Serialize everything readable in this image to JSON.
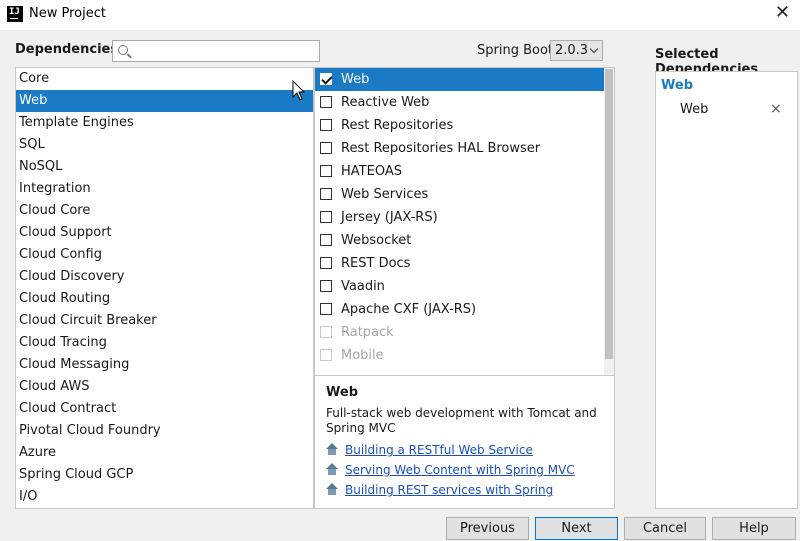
{
  "window": {
    "app_icon_text": "IJ",
    "title": "New Project",
    "close_glyph": "✕"
  },
  "header": {
    "dependencies_label": "Dependencies",
    "search_value": "",
    "spring_boot_label": "Spring Boot",
    "spring_boot_version": "2.0.3"
  },
  "categories": [
    {
      "label": "Core"
    },
    {
      "label": "Web",
      "selected": true
    },
    {
      "label": "Template Engines"
    },
    {
      "label": "SQL"
    },
    {
      "label": "NoSQL"
    },
    {
      "label": "Integration"
    },
    {
      "label": "Cloud Core"
    },
    {
      "label": "Cloud Support"
    },
    {
      "label": "Cloud Config"
    },
    {
      "label": "Cloud Discovery"
    },
    {
      "label": "Cloud Routing"
    },
    {
      "label": "Cloud Circuit Breaker"
    },
    {
      "label": "Cloud Tracing"
    },
    {
      "label": "Cloud Messaging"
    },
    {
      "label": "Cloud AWS"
    },
    {
      "label": "Cloud Contract"
    },
    {
      "label": "Pivotal Cloud Foundry"
    },
    {
      "label": "Azure"
    },
    {
      "label": "Spring Cloud GCP"
    },
    {
      "label": "I/O"
    }
  ],
  "dependencies": [
    {
      "label": "Web",
      "checked": true,
      "selected": true
    },
    {
      "label": "Reactive Web"
    },
    {
      "label": "Rest Repositories"
    },
    {
      "label": "Rest Repositories HAL Browser"
    },
    {
      "label": "HATEOAS"
    },
    {
      "label": "Web Services"
    },
    {
      "label": "Jersey (JAX-RS)"
    },
    {
      "label": "Websocket"
    },
    {
      "label": "REST Docs"
    },
    {
      "label": "Vaadin"
    },
    {
      "label": "Apache CXF (JAX-RS)"
    },
    {
      "label": "Ratpack",
      "disabled": true
    },
    {
      "label": "Mobile",
      "disabled": true
    }
  ],
  "info": {
    "title": "Web",
    "description": "Full-stack web development with Tomcat and Spring MVC",
    "links": [
      {
        "label": "Building a RESTful Web Service"
      },
      {
        "label": "Serving Web Content with Spring MVC"
      },
      {
        "label": "Building REST services with Spring"
      }
    ]
  },
  "selected": {
    "label": "Selected Dependencies",
    "group": "Web",
    "items": [
      {
        "label": "Web",
        "remove_glyph": "×"
      }
    ]
  },
  "buttons": {
    "previous": "Previous",
    "next": "Next",
    "cancel": "Cancel",
    "help": "Help"
  },
  "colors": {
    "selection": "#1b7ac6",
    "link": "#1a4fc1"
  }
}
